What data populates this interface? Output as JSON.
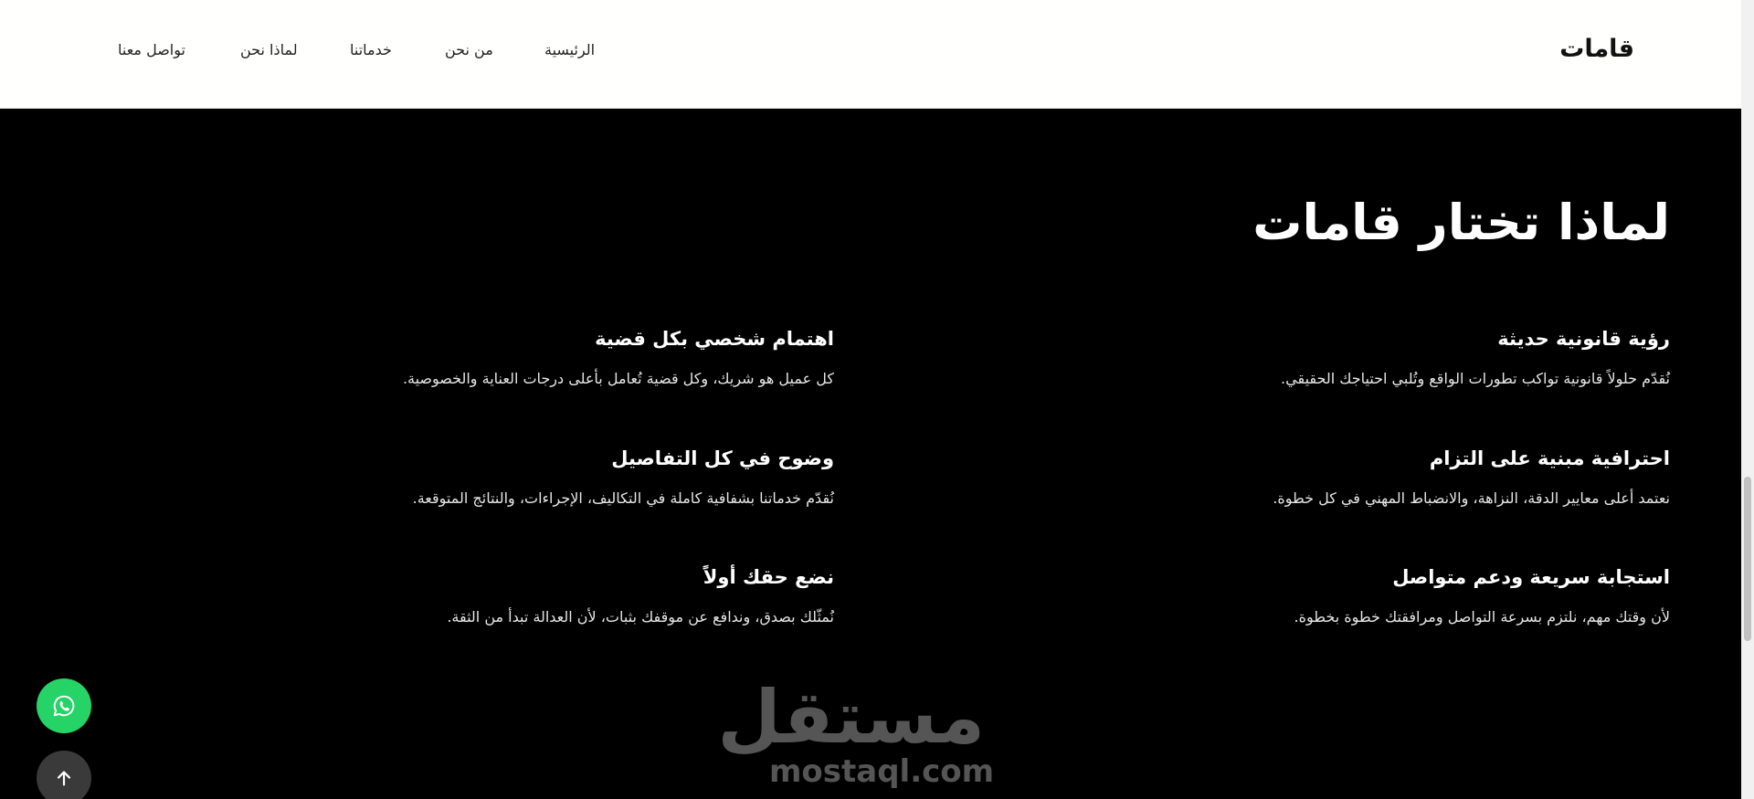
{
  "header": {
    "brand": "قامات",
    "nav": [
      "الرئيسية",
      "من نحن",
      "خدماتنا",
      "لماذا نحن",
      "تواصل معنا"
    ]
  },
  "section": {
    "title": "لماذا تختار قامات",
    "features": [
      {
        "title": "رؤية قانونية حديثة",
        "desc": "نُقدّم حلولاً قانونية تواكب تطورات الواقع وتُلبي احتياجك الحقيقي."
      },
      {
        "title": "اهتمام شخصي بكل قضية",
        "desc": "كل عميل هو شريك، وكل قضية تُعامل بأعلى درجات العناية والخصوصية."
      },
      {
        "title": "احترافية مبنية على التزام",
        "desc": "نعتمد أعلى معايير الدقة، النزاهة، والانضباط المهني في كل خطوة."
      },
      {
        "title": "وضوح في كل التفاصيل",
        "desc": "نُقدّم خدماتنا بشفافية كاملة في التكاليف، الإجراءات، والنتائج المتوقعة."
      },
      {
        "title": "استجابة سريعة ودعم متواصل",
        "desc": "لأن وقتك مهم، نلتزم بسرعة التواصل ومرافقتك خطوة بخطوة."
      },
      {
        "title": "نضع حقك أولاً",
        "desc": "نُمثّلك بصدق، وندافع عن موقفك بثبات، لأن العدالة تبدأ من الثقة."
      }
    ]
  },
  "watermark": {
    "arabic": "مستقل",
    "latin": "mostaql.com"
  },
  "icons": {
    "whatsapp": "whatsapp-icon",
    "scroll_top": "arrow-up-icon"
  },
  "colors": {
    "whatsapp": "#25d366",
    "scroll_top_bg": "#3a3a3a",
    "background": "#000000",
    "header_bg": "#fffffe"
  }
}
